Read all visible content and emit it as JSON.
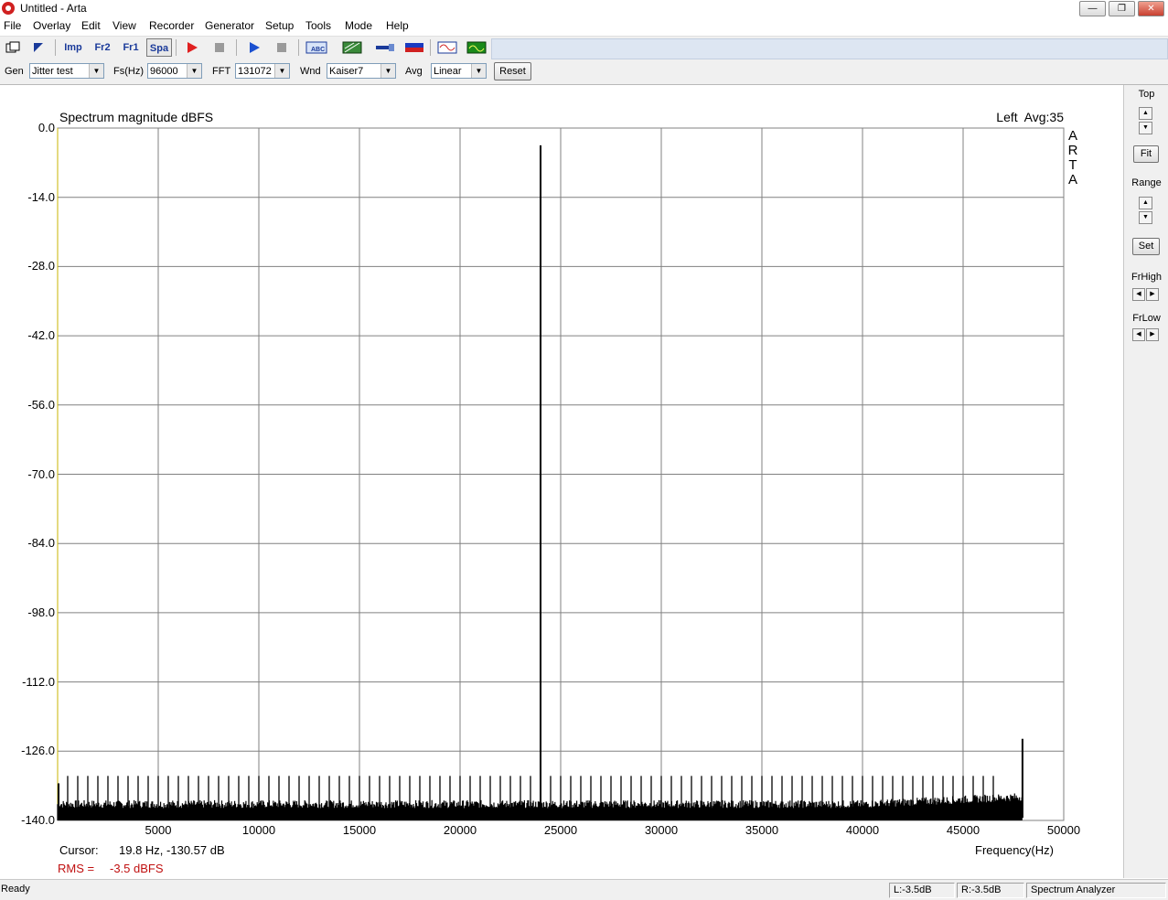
{
  "window": {
    "title": "Untitled - Arta",
    "minimize": "—",
    "restore": "❐",
    "close": "✕"
  },
  "menu": [
    "File",
    "Overlay",
    "Edit",
    "View",
    "Recorder",
    "Generator",
    "Setup",
    "Tools",
    "Mode",
    "Help"
  ],
  "toolbar": {
    "imp": "Imp",
    "fr2": "Fr2",
    "fr1": "Fr1",
    "spa": "Spa",
    "abc": "ABC"
  },
  "controls": {
    "gen_label": "Gen",
    "gen_value": "Jitter test",
    "fs_label": "Fs(Hz)",
    "fs_value": "96000",
    "fft_label": "FFT",
    "fft_value": "131072",
    "wnd_label": "Wnd",
    "wnd_value": "Kaiser7",
    "avg_label": "Avg",
    "avg_value": "Linear",
    "reset": "Reset"
  },
  "side_panel": {
    "top": "Top",
    "fit": "Fit",
    "range": "Range",
    "set": "Set",
    "frhigh": "FrHigh",
    "frlow": "FrLow"
  },
  "plot": {
    "title": "Spectrum magnitude dBFS",
    "channel_info": "Left  Avg:35",
    "watermark": [
      "A",
      "R",
      "T",
      "A"
    ],
    "cursor_label": "Cursor:",
    "cursor_value": "19.8 Hz, -130.57 dB",
    "rms_label": "RMS =",
    "rms_value": "-3.5 dBFS",
    "xlabel": "Frequency(Hz)"
  },
  "status": {
    "ready": "Ready",
    "left": "L:-3.5dB",
    "right": "R:-3.5dB",
    "mode": "Spectrum Analyzer"
  },
  "chart_data": {
    "type": "line",
    "title": "Spectrum magnitude dBFS",
    "xlabel": "Frequency(Hz)",
    "ylabel": "",
    "xlim": [
      0,
      50000
    ],
    "ylim": [
      -140,
      0
    ],
    "x_ticks": [
      5000,
      10000,
      15000,
      20000,
      25000,
      30000,
      35000,
      40000,
      45000,
      50000
    ],
    "y_ticks": [
      0.0,
      -14.0,
      -28.0,
      -42.0,
      -56.0,
      -70.0,
      -84.0,
      -98.0,
      -112.0,
      -126.0,
      -140.0
    ],
    "grid": true,
    "noise_floor_db": -137.5,
    "peaks": [
      {
        "freq": 24000,
        "db": -3.5
      },
      {
        "freq": 47950,
        "db": -123.5
      },
      {
        "freq": 0,
        "db": -132.5
      }
    ],
    "sidebands": {
      "spacing_hz": 500,
      "db": -131,
      "from_hz": 500,
      "to_hz": 46500
    }
  }
}
